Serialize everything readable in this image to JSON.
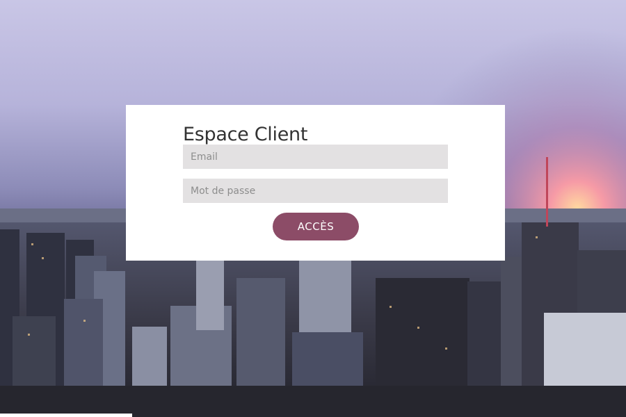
{
  "login": {
    "title": "Espace Client",
    "email_placeholder": "Email",
    "password_placeholder": "Mot de passe",
    "submit_label": "ACCÈS"
  },
  "colors": {
    "card_background": "#ffffff",
    "field_background": "#e3e1e2",
    "button_background": "#8c4c67",
    "sky_top": "#c9c4e4",
    "sunset": "#f09aa8"
  },
  "background": {
    "description_icon": "city-skyline-background"
  }
}
